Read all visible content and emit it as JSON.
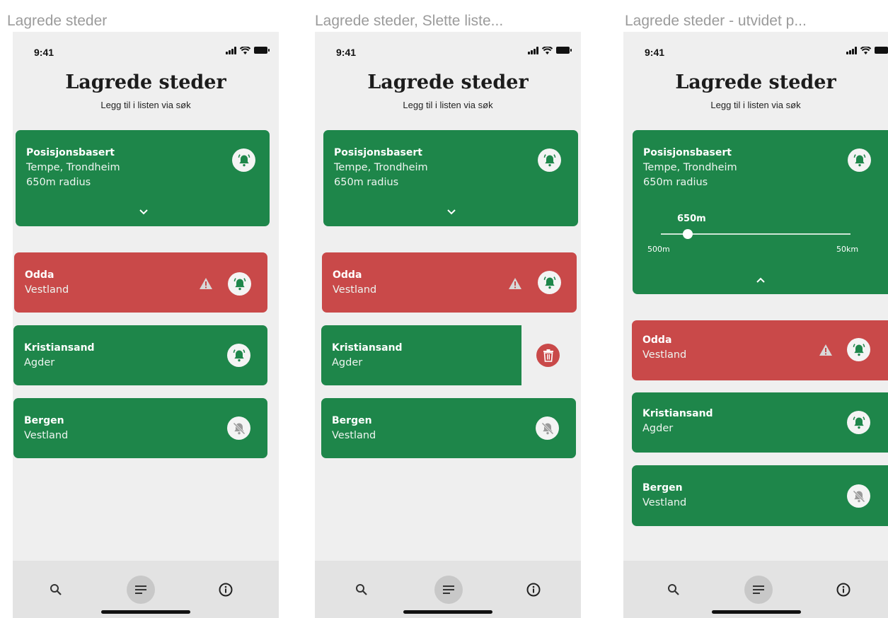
{
  "frames": [
    {
      "frame_title": "Lagrede steder",
      "status_time": "9:41",
      "page_title": "Lagrede steder",
      "page_subtitle": "Legg til i listen via søk",
      "position_card": {
        "title": "Posisjonsbasert",
        "line1": "Tempe, Trondheim",
        "line2": "650m radius"
      },
      "items": [
        {
          "title": "Odda",
          "subtitle": "Vestland"
        },
        {
          "title": "Kristiansand",
          "subtitle": "Agder"
        },
        {
          "title": "Bergen",
          "subtitle": "Vestland"
        }
      ]
    },
    {
      "frame_title": "Lagrede steder, Slette liste...",
      "status_time": "9:41",
      "page_title": "Lagrede steder",
      "page_subtitle": "Legg til i listen via søk",
      "position_card": {
        "title": "Posisjonsbasert",
        "line1": "Tempe, Trondheim",
        "line2": "650m radius"
      },
      "items": [
        {
          "title": "Odda",
          "subtitle": "Vestland"
        },
        {
          "title": "Kristiansand",
          "subtitle": "Agder"
        },
        {
          "title": "Bergen",
          "subtitle": "Vestland"
        }
      ]
    },
    {
      "frame_title": "Lagrede steder - utvidet p...",
      "status_time": "9:41",
      "page_title": "Lagrede steder",
      "page_subtitle": "Legg til i listen via søk",
      "position_card": {
        "title": "Posisjonsbasert",
        "line1": "Tempe, Trondheim",
        "line2": "650m radius"
      },
      "slider": {
        "value_label": "650m",
        "min_label": "500m",
        "max_label": "50km"
      },
      "items": [
        {
          "title": "Odda",
          "subtitle": "Vestland"
        },
        {
          "title": "Kristiansand",
          "subtitle": "Agder"
        },
        {
          "title": "Bergen",
          "subtitle": "Vestland"
        }
      ]
    }
  ],
  "colors": {
    "green": "#1e864a",
    "red": "#c94949",
    "background": "#efefef",
    "tabbar": "#e3e3e3"
  },
  "icons": [
    "bell-icon",
    "bell-off-icon",
    "warning-icon",
    "chevron-down-icon",
    "chevron-up-icon",
    "trash-icon",
    "search-icon",
    "list-icon",
    "info-icon"
  ]
}
